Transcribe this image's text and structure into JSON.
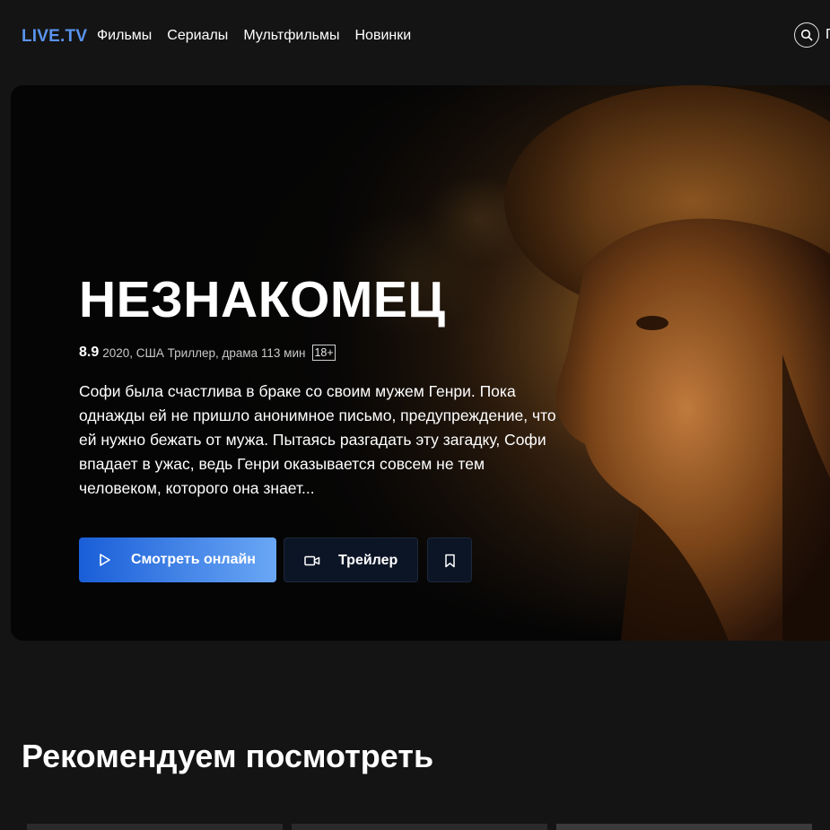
{
  "header": {
    "logo": "LIVE.TV",
    "nav": [
      "Фильмы",
      "Сериалы",
      "Мультфильмы",
      "Новинки"
    ],
    "cut_label": "П"
  },
  "hero": {
    "title": "НЕЗНАКОМЕЦ",
    "rating": "8.9",
    "meta": "2020, США Триллер, драма 113 мин",
    "age": "18+",
    "description": "Софи была счастлива в браке со своим мужем Генри. Пока однажды ей не пришло анонимное письмо, предупреждение, что ей нужно бежать от мужа. Пытаясь разгадать эту загадку, Софи впадает в ужас, ведь Генри оказывается совсем не тем человеком, которого она знает...",
    "watch_label": "Смотреть онлайн",
    "trailer_label": "Трейлер"
  },
  "recommend": {
    "title": "Рекомендуем посмотреть"
  },
  "icons": {
    "search": "search-icon",
    "play": "play-icon",
    "video": "video-camera-icon",
    "bookmark": "bookmark-icon"
  },
  "colors": {
    "background": "#141414",
    "logo": "#5a93ee",
    "watch_gradient_start": "#1a5ed8",
    "watch_gradient_end": "#6aa7f5",
    "secondary_button": "#0c1526"
  }
}
